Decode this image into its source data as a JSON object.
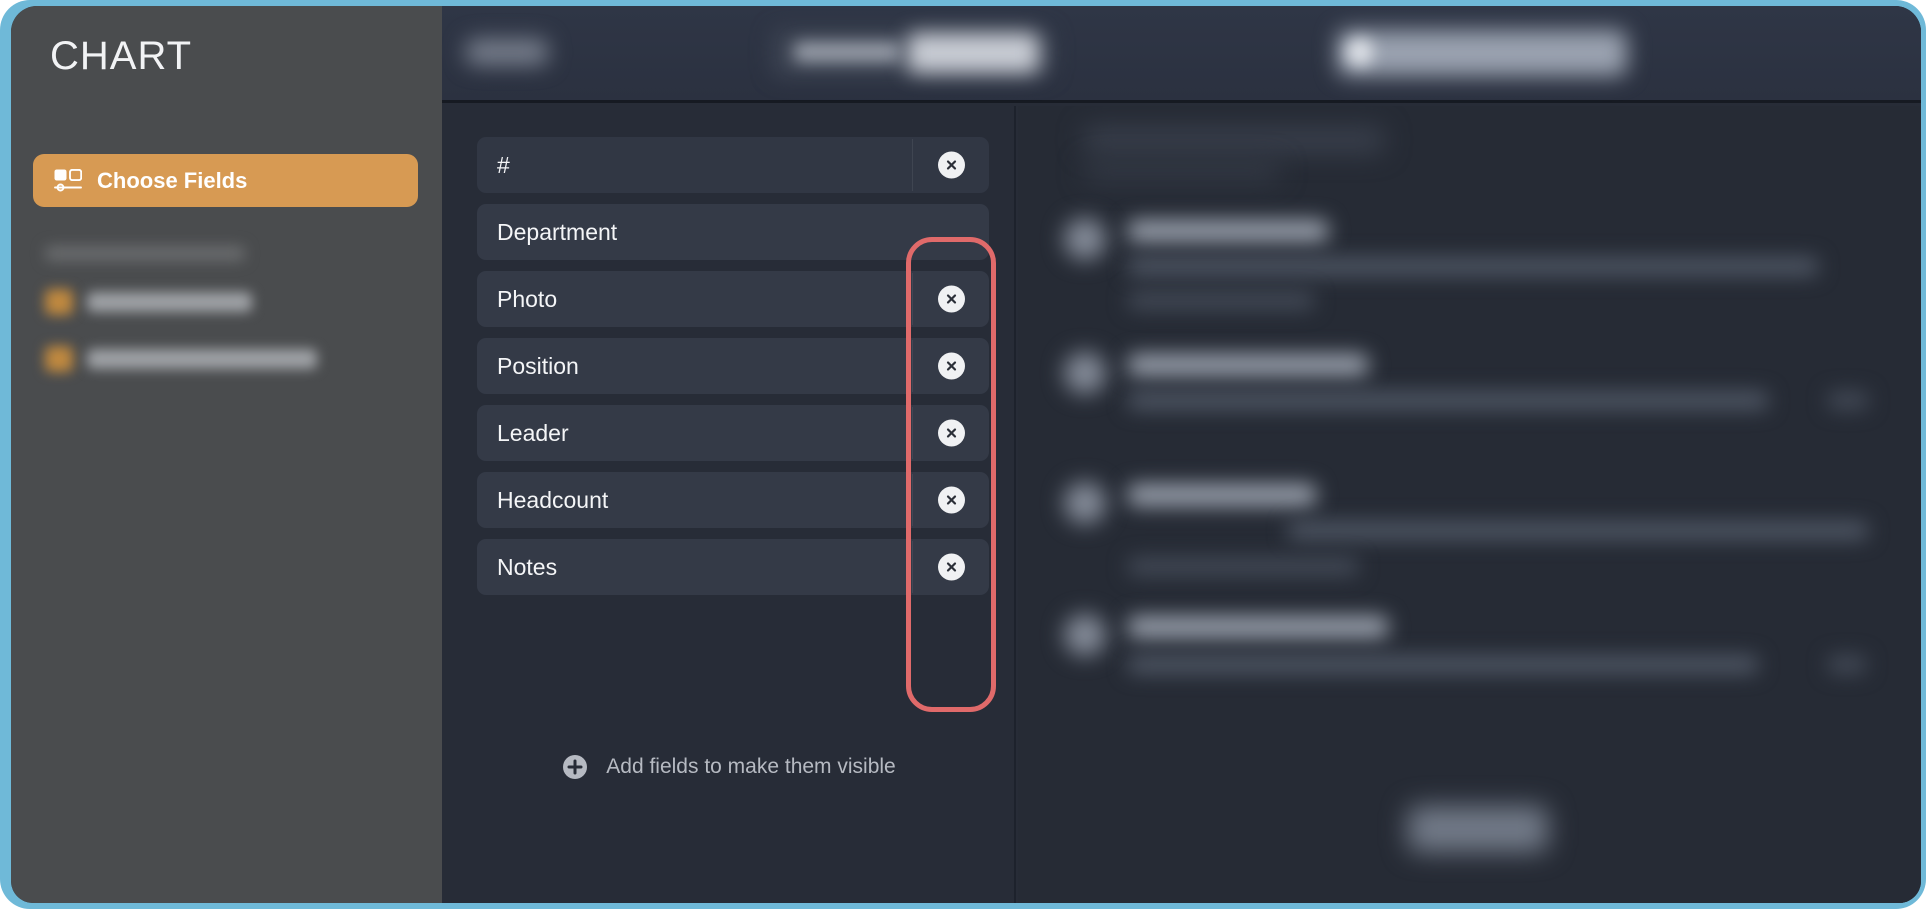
{
  "window": {
    "frame_color": "#6fb9d8",
    "app_background": "#2b313d"
  },
  "sidebar": {
    "title": "CHART",
    "background": "#4a4c4e",
    "primary_button": {
      "label": "Choose Fields",
      "icon": "fields-columns-icon",
      "color": "#d79a53"
    },
    "blurred_items": [
      {
        "icon": "item-icon",
        "redacted": true
      },
      {
        "icon": "item-icon",
        "redacted": true
      }
    ]
  },
  "topbar": {
    "background": "#2f3646",
    "redacted_controls": [
      {
        "name": "cancel-button",
        "redacted": true
      },
      {
        "name": "segmented-control",
        "redacted": true
      },
      {
        "name": "primary-action-button",
        "redacted": true
      }
    ]
  },
  "fields_panel": {
    "background": "#272c37",
    "rows": [
      {
        "label": "#",
        "has_delete": true,
        "selected": true
      },
      {
        "label": "Department",
        "has_delete": false,
        "selected": false
      },
      {
        "label": "Photo",
        "has_delete": true,
        "selected": false
      },
      {
        "label": "Position",
        "has_delete": true,
        "selected": false
      },
      {
        "label": "Leader",
        "has_delete": true,
        "selected": false
      },
      {
        "label": "Headcount",
        "has_delete": true,
        "selected": false
      },
      {
        "label": "Notes",
        "has_delete": true,
        "selected": false
      }
    ],
    "add_hint": {
      "label": "Add fields to make them visible",
      "icon": "plus-circle-icon"
    },
    "delete_icon": "close-circle-icon"
  },
  "annotation": {
    "name": "delete-column-highlight",
    "color": "#e06a6a",
    "shape": "rounded-rectangle"
  },
  "preview_panel": {
    "background": "#262b35",
    "redacted_rows": [
      {
        "name": "list-item",
        "redacted": true
      },
      {
        "name": "list-item",
        "redacted": true
      },
      {
        "name": "list-item",
        "redacted": true
      },
      {
        "name": "list-item",
        "redacted": true
      }
    ],
    "redacted_button": {
      "name": "footer-button",
      "redacted": true
    }
  }
}
